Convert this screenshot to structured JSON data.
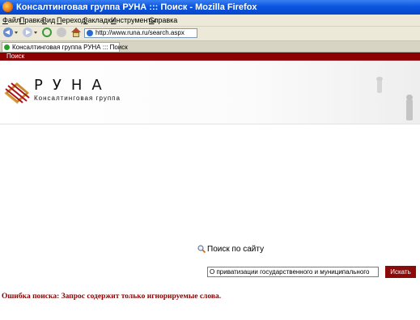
{
  "window": {
    "title": "Консалтинговая группа РУНА ::: Поиск - Mozilla Firefox"
  },
  "menu": {
    "items": [
      "Файл",
      "Правка",
      "Вид",
      "Переход",
      "Закладки",
      "Инструменты",
      "Справка"
    ]
  },
  "navbar": {
    "url": "http://www.runa.ru/search.aspx"
  },
  "tabs": [
    {
      "label": "Консалтинговая группа РУНА ::: Поиск"
    }
  ],
  "site": {
    "breadcrumb": "Поиск",
    "logo": {
      "word": "РУНА",
      "subtitle": "Консалтинговая группа"
    }
  },
  "search": {
    "heading": "Поиск по сайту",
    "query": "О приватизации государственного и муниципального",
    "button_label": "Искать",
    "error": "Ошибка поиска: Запрос содержит только игнорируемые слова."
  },
  "colors": {
    "brand_red": "#8b0000",
    "titlebar_blue": "#0b55e0"
  },
  "icons": [
    "firefox-icon",
    "back-icon",
    "forward-icon",
    "reload-icon",
    "stop-icon",
    "home-icon",
    "page-icon",
    "magnifier-icon"
  ]
}
